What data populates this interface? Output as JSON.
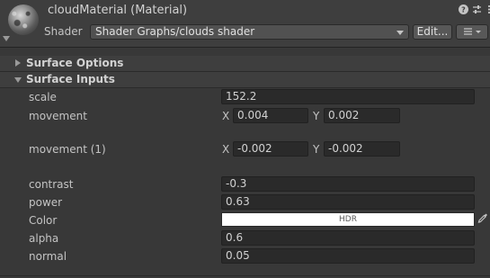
{
  "header": {
    "title": "cloudMaterial (Material)",
    "shader_label": "Shader",
    "shader_value": "Shader Graphs/clouds shader",
    "edit_button": "Edit...",
    "icons": [
      "help-icon",
      "presets-icon",
      "more-menu-icon",
      "list-menu-icon"
    ]
  },
  "sections": {
    "surface_options": "Surface Options",
    "surface_inputs": "Surface Inputs"
  },
  "properties": {
    "scale": {
      "label": "scale",
      "value": "152.2"
    },
    "movement": {
      "label": "movement",
      "x_label": "X",
      "x": "0.004",
      "y_label": "Y",
      "y": "0.002"
    },
    "movement1": {
      "label": "movement (1)",
      "x_label": "X",
      "x": "-0.002",
      "y_label": "Y",
      "y": "-0.002"
    },
    "contrast": {
      "label": "contrast",
      "value": "-0.3"
    },
    "power": {
      "label": "power",
      "value": "0.63"
    },
    "color": {
      "label": "Color",
      "hdr_text": "HDR",
      "swatch_color": "#ffffff"
    },
    "alpha": {
      "label": "alpha",
      "value": "0.6"
    },
    "normal": {
      "label": "normal",
      "value": "0.05"
    }
  }
}
